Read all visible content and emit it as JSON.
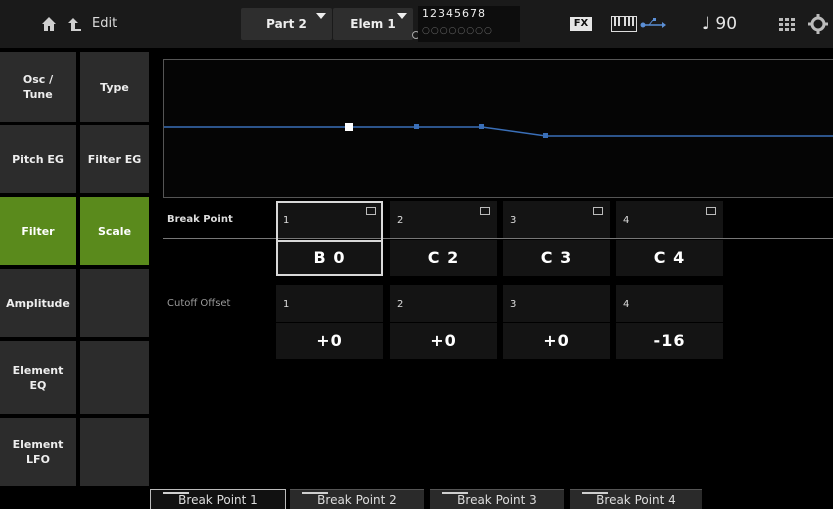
{
  "topbar": {
    "edit_label": "Edit",
    "part_label": "Part 2",
    "elem_label": "Elem 1",
    "element_numbers": "12345678",
    "element_dots": "○○○○○○○○",
    "fx_label": "FX",
    "tempo": "♩ 90",
    "icons": [
      "home-icon",
      "back-icon",
      "keyboard-icon",
      "usb-icon",
      "grid-icon",
      "gear-icon"
    ]
  },
  "left_tabs": {
    "osc_tune": "Osc /\nTune",
    "type": "Type",
    "pitch_eg": "Pitch EG",
    "filter_eg": "Filter EG",
    "filter": "Filter",
    "scale": "Scale",
    "amplitude": "Amplitude",
    "element_eq": "Element\nEQ",
    "element_lfo": "Element\nLFO"
  },
  "params": {
    "break_point_label": "Break Point",
    "cutoff_offset_label": "Cutoff Offset",
    "break_points": [
      {
        "num": "1",
        "value": "B 0"
      },
      {
        "num": "2",
        "value": "C 2"
      },
      {
        "num": "3",
        "value": "C 3"
      },
      {
        "num": "4",
        "value": "C 4"
      }
    ],
    "cutoff_offsets": [
      {
        "num": "1",
        "value": "+0"
      },
      {
        "num": "2",
        "value": "+0"
      },
      {
        "num": "3",
        "value": "+0"
      },
      {
        "num": "4",
        "value": "-16"
      }
    ]
  },
  "bottom_tabs": [
    "Break Point 1",
    "Break Point 2",
    "Break Point 3",
    "Break Point 4"
  ],
  "colors": {
    "accent_green": "#5a8a1c",
    "curve_blue": "#3a6fb8"
  }
}
